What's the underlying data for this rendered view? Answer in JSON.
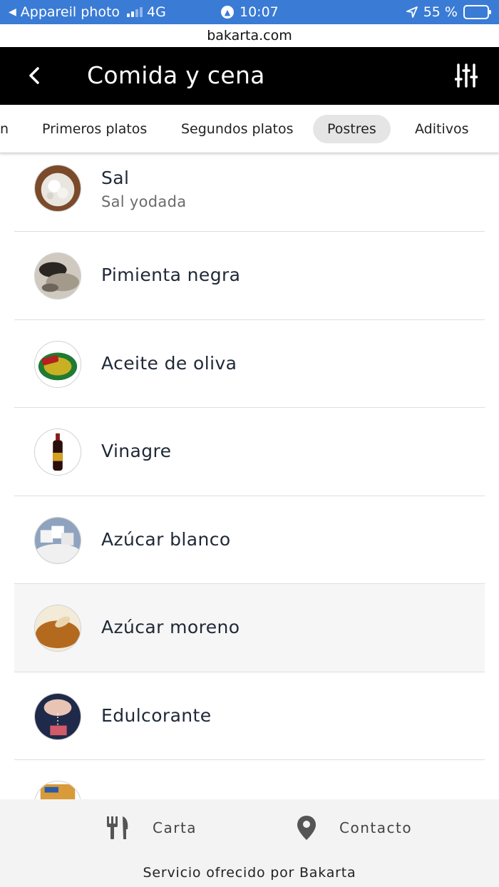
{
  "status_bar": {
    "back_app": "Appareil photo",
    "network": "4G",
    "time": "10:07",
    "battery": "55 %",
    "battery_level": 0.55,
    "background_color": "#3a7bd5"
  },
  "browser": {
    "url": "bakarta.com"
  },
  "header": {
    "title": "Comida y cena",
    "back_icon": "chevron-left-icon",
    "filter_icon": "sliders-icon",
    "background_color": "#000000"
  },
  "tabs": {
    "partial_left": "n",
    "items": [
      {
        "label": "Primeros platos",
        "active": false
      },
      {
        "label": "Segundos platos",
        "active": false
      },
      {
        "label": "Postres",
        "active": true
      },
      {
        "label": "Aditivos",
        "active": false
      }
    ]
  },
  "products": [
    {
      "name": "Sal",
      "subtitle": "Sal yodada",
      "icon": "salt-photo"
    },
    {
      "name": "Pimienta negra",
      "icon": "pepper-photo"
    },
    {
      "name": "Aceite de oliva",
      "icon": "olive-oil-photo"
    },
    {
      "name": "Vinagre",
      "icon": "vinegar-photo"
    },
    {
      "name": "Azúcar blanco",
      "icon": "white-sugar-photo"
    },
    {
      "name": "Azúcar moreno",
      "icon": "brown-sugar-photo",
      "highlighted": true
    },
    {
      "name": "Edulcorante",
      "icon": "sweetener-photo"
    },
    {
      "name": "",
      "icon": "packet-photo"
    }
  ],
  "footer": {
    "menu_label": "Carta",
    "menu_icon": "fork-knife-icon",
    "contact_label": "Contacto",
    "contact_icon": "location-pin-icon",
    "powered_by": "Servicio ofrecido por Bakarta"
  }
}
